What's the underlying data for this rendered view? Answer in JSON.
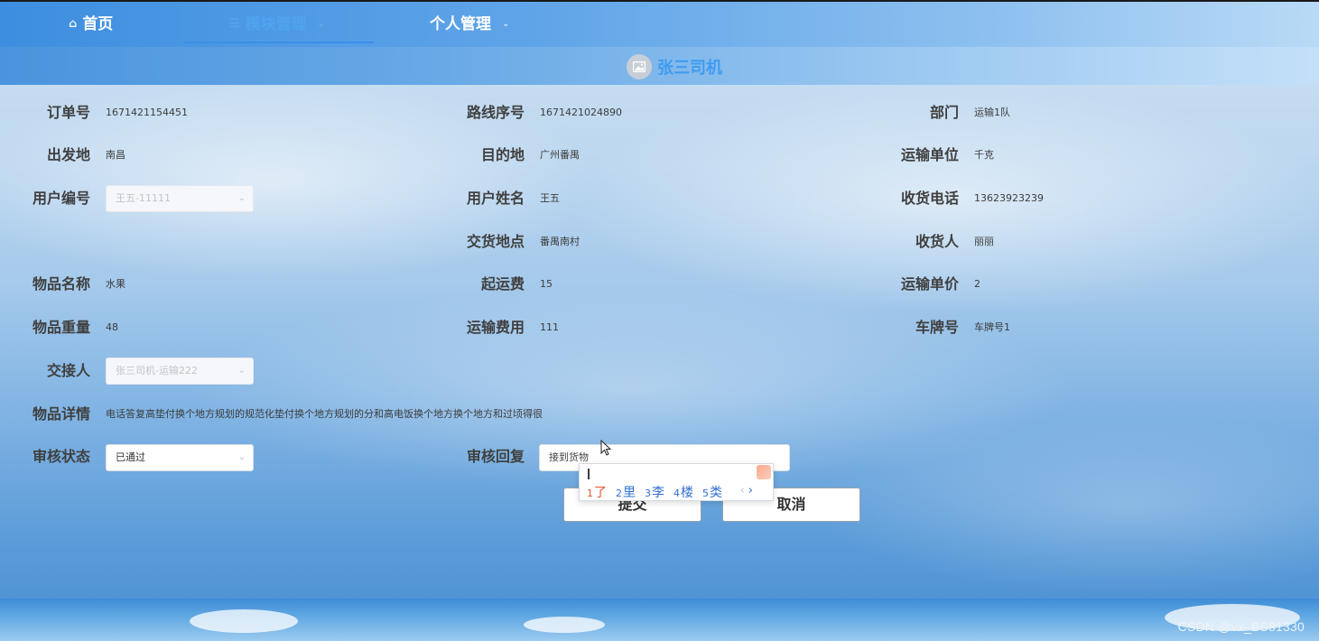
{
  "nav": {
    "items": [
      {
        "label": "首页",
        "icon": "home-icon",
        "active": false
      },
      {
        "label": "模块管理",
        "icon": "list-icon",
        "active": true
      },
      {
        "label": "个人管理",
        "icon": "",
        "active": false
      }
    ]
  },
  "user": {
    "name": "张三司机",
    "avatar_icon": "image-placeholder-icon"
  },
  "form": {
    "order_no": {
      "label": "订单号",
      "value": "1671421154451"
    },
    "route_no": {
      "label": "路线序号",
      "value": "1671421024890"
    },
    "department": {
      "label": "部门",
      "value": "运输1队"
    },
    "origin": {
      "label": "出发地",
      "value": "南昌"
    },
    "destination": {
      "label": "目的地",
      "value": "广州番禺"
    },
    "transport_unit": {
      "label": "运输单位",
      "value": "千克"
    },
    "user_no": {
      "label": "用户编号",
      "value": "王五-11111"
    },
    "user_name": {
      "label": "用户姓名",
      "value": "王五"
    },
    "receiver_phone": {
      "label": "收货电话",
      "value": "13623923239"
    },
    "delivery_place": {
      "label": "交货地点",
      "value": "番禺南村"
    },
    "receiver": {
      "label": "收货人",
      "value": "丽丽"
    },
    "goods_name": {
      "label": "物品名称",
      "value": "水果"
    },
    "base_fee": {
      "label": "起运费",
      "value": "15"
    },
    "unit_price": {
      "label": "运输单价",
      "value": "2"
    },
    "goods_weight": {
      "label": "物品重量",
      "value": "48"
    },
    "transport_fee": {
      "label": "运输费用",
      "value": "111"
    },
    "plate_no": {
      "label": "车牌号",
      "value": "车牌号1"
    },
    "handover": {
      "label": "交接人",
      "value": "张三司机-运输222"
    },
    "goods_detail": {
      "label": "物品详情",
      "value": "电话答复高垫付换个地方规划的规范化垫付换个地方规划的分和高电饭换个地方换个地方和过顷得很"
    },
    "audit_status": {
      "label": "审核状态",
      "value": "已通过"
    },
    "audit_reply": {
      "label": "审核回复",
      "value": "接到货物"
    }
  },
  "buttons": {
    "submit": "提交",
    "cancel": "取消"
  },
  "ime": {
    "candidates": [
      {
        "n": "1",
        "text": "了"
      },
      {
        "n": "2",
        "text": "里"
      },
      {
        "n": "3",
        "text": "李"
      },
      {
        "n": "4",
        "text": "楼"
      },
      {
        "n": "5",
        "text": "类"
      }
    ],
    "prev": "‹",
    "next": "›"
  },
  "watermark": "CSDN @vx_BS81330",
  "colors": {
    "accent": "#3f9bf0",
    "nav_active": "#4fa4f0"
  }
}
